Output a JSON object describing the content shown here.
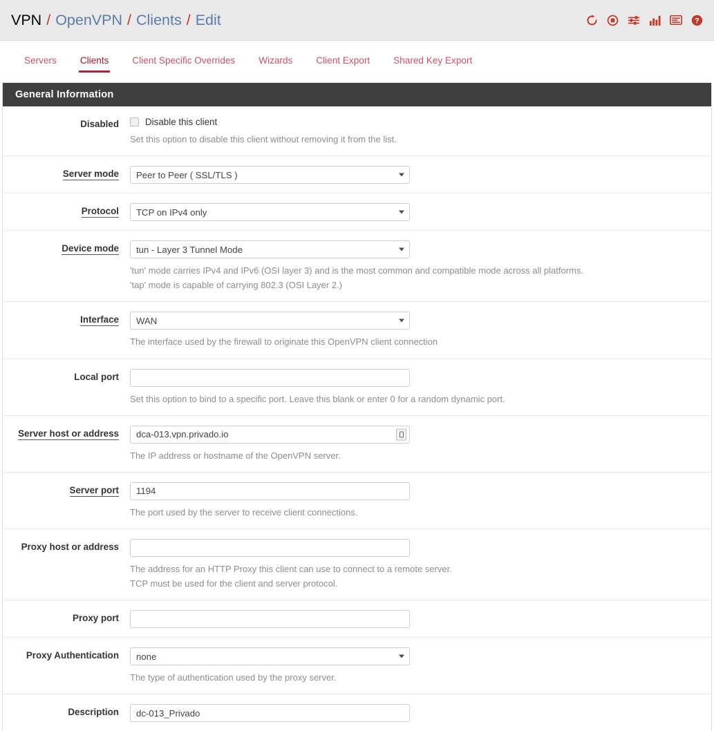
{
  "header": {
    "breadcrumb": {
      "root": "VPN",
      "separator": "/",
      "links": [
        "OpenVPN",
        "Clients",
        "Edit"
      ]
    },
    "icons": [
      {
        "name": "refresh-icon",
        "label": "Restart"
      },
      {
        "name": "stop-circle-icon",
        "label": "Stop"
      },
      {
        "name": "sliders-icon",
        "label": "Settings"
      },
      {
        "name": "bar-chart-icon",
        "label": "Status Monitoring"
      },
      {
        "name": "logs-icon",
        "label": "System Logs"
      },
      {
        "name": "help-icon",
        "label": "Help"
      }
    ],
    "accent_color": "#c0392b",
    "link_color": "#5b7ba8",
    "background_color": "#e9e9e9"
  },
  "tabs": [
    {
      "label": "Servers",
      "active": false
    },
    {
      "label": "Clients",
      "active": true
    },
    {
      "label": "Client Specific Overrides",
      "active": false
    },
    {
      "label": "Wizards",
      "active": false
    },
    {
      "label": "Client Export",
      "active": false
    },
    {
      "label": "Shared Key Export",
      "active": false
    }
  ],
  "panel": {
    "heading": "General Information",
    "heading_bg": "#3f3f3f"
  },
  "form": {
    "disabled": {
      "label": "Disabled",
      "label_underlined": false,
      "checkbox_label": "Disable this client",
      "checked": false,
      "help": [
        "Set this option to disable this client without removing it from the list."
      ]
    },
    "server_mode": {
      "label": "Server mode",
      "label_underlined": true,
      "value": "Peer to Peer ( SSL/TLS )",
      "control": "select",
      "help": []
    },
    "protocol": {
      "label": "Protocol",
      "label_underlined": true,
      "value": "TCP on IPv4 only",
      "control": "select",
      "help": []
    },
    "device_mode": {
      "label": "Device mode",
      "label_underlined": true,
      "value": "tun - Layer 3 Tunnel Mode",
      "control": "select",
      "help": [
        "'tun' mode carries IPv4 and IPv6 (OSI layer 3) and is the most common and compatible mode across all platforms.",
        "'tap' mode is capable of carrying 802.3 (OSI Layer 2.)"
      ]
    },
    "interface": {
      "label": "Interface",
      "label_underlined": true,
      "value": "WAN",
      "control": "select",
      "help": [
        "The interface used by the firewall to originate this OpenVPN client connection"
      ]
    },
    "local_port": {
      "label": "Local port",
      "label_underlined": false,
      "value": "",
      "placeholder": "",
      "control": "input",
      "help": [
        "Set this option to bind to a specific port. Leave this blank or enter 0 for a random dynamic port."
      ]
    },
    "server_host": {
      "label": "Server host or address",
      "label_underlined": true,
      "value": "dca-013.vpn.privado.io",
      "placeholder": "",
      "control": "input",
      "trailing_icon": "autofill-icon",
      "help": [
        "The IP address or hostname of the OpenVPN server."
      ]
    },
    "server_port": {
      "label": "Server port",
      "label_underlined": true,
      "value": "1194",
      "placeholder": "",
      "control": "input",
      "help": [
        "The port used by the server to receive client connections."
      ]
    },
    "proxy_host": {
      "label": "Proxy host or address",
      "label_underlined": false,
      "value": "",
      "placeholder": "",
      "control": "input",
      "help": [
        "The address for an HTTP Proxy this client can use to connect to a remote server.",
        "TCP must be used for the client and server protocol."
      ]
    },
    "proxy_port": {
      "label": "Proxy port",
      "label_underlined": false,
      "value": "",
      "placeholder": "",
      "control": "input",
      "help": []
    },
    "proxy_auth": {
      "label": "Proxy Authentication",
      "label_underlined": false,
      "value": "none",
      "control": "select",
      "help": [
        "The type of authentication used by the proxy server."
      ]
    },
    "description": {
      "label": "Description",
      "label_underlined": false,
      "value": "dc-013_Privado",
      "placeholder": "",
      "control": "input",
      "help": []
    }
  }
}
